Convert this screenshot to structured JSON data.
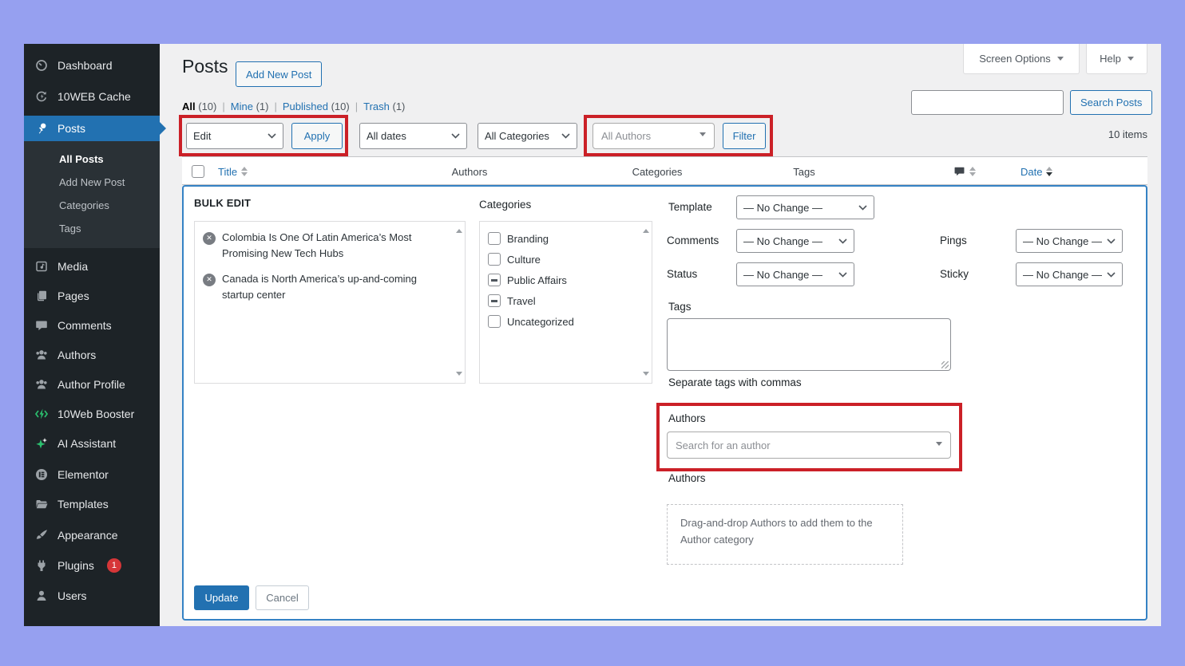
{
  "colors": {
    "accent": "#2271b1",
    "annotation_red": "#cb2027",
    "sidebar_bg": "#1d2327",
    "badge_red": "#d63638",
    "frame": "#96a0f0"
  },
  "sidebar": {
    "items": [
      {
        "label": "Dashboard",
        "icon": "dashboard-icon"
      },
      {
        "label": "10WEB Cache",
        "icon": "cache-icon"
      },
      {
        "label": "Posts",
        "icon": "pushpin-icon",
        "active": true
      },
      {
        "label": "Media",
        "icon": "media-icon"
      },
      {
        "label": "Pages",
        "icon": "pages-icon"
      },
      {
        "label": "Comments",
        "icon": "comments-icon"
      },
      {
        "label": "Authors",
        "icon": "group-icon"
      },
      {
        "label": "Author Profile",
        "icon": "group-icon"
      },
      {
        "label": "10Web Booster",
        "icon": "booster-icon"
      },
      {
        "label": "AI Assistant",
        "icon": "sparkle-icon"
      },
      {
        "label": "Elementor",
        "icon": "elementor-icon"
      },
      {
        "label": "Templates",
        "icon": "folder-icon"
      },
      {
        "label": "Appearance",
        "icon": "brush-icon"
      },
      {
        "label": "Plugins",
        "icon": "plugin-icon",
        "badge": "1"
      },
      {
        "label": "Users",
        "icon": "user-icon"
      }
    ],
    "posts_submenu": [
      "All Posts",
      "Add New Post",
      "Categories",
      "Tags"
    ]
  },
  "header": {
    "title": "Posts",
    "add_new_button": "Add New Post",
    "screen_options": "Screen Options",
    "help": "Help"
  },
  "views": {
    "sep": "|",
    "items": [
      {
        "label": "All",
        "count": "(10)",
        "current": true
      },
      {
        "label": "Mine",
        "count": "(1)"
      },
      {
        "label": "Published",
        "count": "(10)"
      },
      {
        "label": "Trash",
        "count": "(1)"
      }
    ]
  },
  "search": {
    "button": "Search Posts",
    "value": ""
  },
  "filters": {
    "bulk_action_selected": "Edit",
    "apply_button": "Apply",
    "dates_selected": "All dates",
    "categories_selected": "All Categories",
    "authors_placeholder": "All Authors",
    "filter_button": "Filter",
    "items_count": "10 items"
  },
  "table": {
    "columns": {
      "title": "Title",
      "authors": "Authors",
      "categories": "Categories",
      "tags": "Tags",
      "date": "Date"
    }
  },
  "bulk_edit": {
    "title": "BULK EDIT",
    "selected_posts": [
      "Colombia Is One Of Latin America’s Most Promising New Tech Hubs",
      "Canada is North America’s up-and-coming startup center"
    ],
    "categories_label": "Categories",
    "categories": [
      {
        "label": "Branding",
        "state": "unchecked"
      },
      {
        "label": "Culture",
        "state": "unchecked"
      },
      {
        "label": "Public Affairs",
        "state": "indeterminate"
      },
      {
        "label": "Travel",
        "state": "indeterminate"
      },
      {
        "label": "Uncategorized",
        "state": "unchecked"
      }
    ],
    "fields": {
      "template_label": "Template",
      "comments_label": "Comments",
      "status_label": "Status",
      "pings_label": "Pings",
      "sticky_label": "Sticky",
      "no_change": "— No Change —"
    },
    "tags_label": "Tags",
    "tags_value": "",
    "tags_hint": "Separate tags with commas",
    "authors_label": "Authors",
    "authors_search_placeholder": "Search for an author",
    "authors_heading": "Authors",
    "drag_drop_hint": "Drag-and-drop Authors to add them to the Author category",
    "update_button": "Update",
    "cancel_button": "Cancel"
  }
}
